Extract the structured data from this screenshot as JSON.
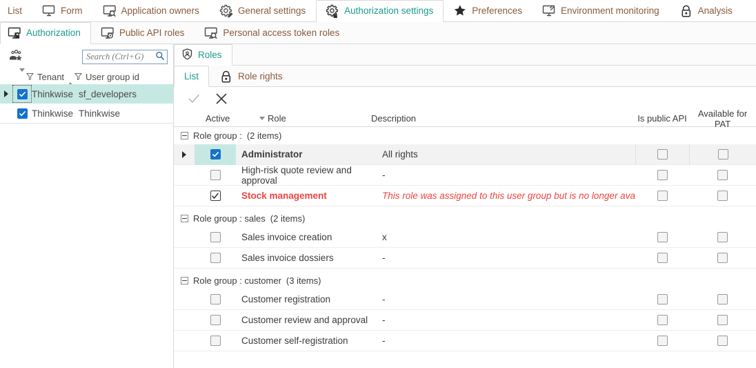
{
  "top_tabs": [
    {
      "label": "List",
      "icon": "list-icon",
      "active": false,
      "has_icon": false
    },
    {
      "label": "Form",
      "icon": "monitor-icon",
      "active": false,
      "has_icon": true
    },
    {
      "label": "Application owners",
      "icon": "monitor-search-icon",
      "active": false,
      "has_icon": true
    },
    {
      "label": "General settings",
      "icon": "gear-pencil-icon",
      "active": false,
      "has_icon": true
    },
    {
      "label": "Authorization settings",
      "icon": "gear-lock-icon",
      "active": true,
      "has_icon": true
    },
    {
      "label": "Preferences",
      "icon": "star-icon",
      "active": false,
      "has_icon": true
    },
    {
      "label": "Environment monitoring",
      "icon": "monitor-activity-icon",
      "active": false,
      "has_icon": true
    },
    {
      "label": "Analysis",
      "icon": "lock-icon",
      "active": false,
      "has_icon": true
    }
  ],
  "sub_tabs": [
    {
      "label": "Authorization",
      "icon": "monitor-lock-icon",
      "active": true
    },
    {
      "label": "Public API roles",
      "icon": "monitor-eye-icon",
      "active": false
    },
    {
      "label": "Personal access token roles",
      "icon": "monitor-search-icon",
      "active": false
    }
  ],
  "left_panel": {
    "header_icon": "user-group-star-icon",
    "search": {
      "placeholder": "Search (Ctrl+G)",
      "value": "",
      "icon": "search-icon"
    },
    "columns": [
      {
        "label": "Tenant",
        "sort": "desc",
        "filter": true
      },
      {
        "label": "User group id",
        "sort": "asc",
        "filter": true
      }
    ],
    "rows": [
      {
        "expandable": true,
        "checked": true,
        "tenant": "Thinkwise",
        "user_group_id": "sf_developers",
        "selected": true
      },
      {
        "expandable": false,
        "checked": true,
        "tenant": "Thinkwise",
        "user_group_id": "Thinkwise",
        "selected": false
      }
    ]
  },
  "right_panel": {
    "entity_tab": {
      "label": "Roles",
      "icon": "shield-user-icon",
      "active": true
    },
    "view_tabs": [
      {
        "label": "List",
        "icon": null,
        "active": true
      },
      {
        "label": "Role rights",
        "icon": "lock-icon",
        "active": false
      }
    ],
    "toolbar": [
      {
        "name": "confirm-button",
        "icon": "check-icon",
        "enabled": false
      },
      {
        "name": "cancel-button",
        "icon": "close-icon",
        "enabled": true
      }
    ],
    "grid": {
      "columns": {
        "active": "Active",
        "active_sort": "desc",
        "role": "Role",
        "description": "Description",
        "is_public_api": "Is public API",
        "available_for_pat": "Available for PAT"
      },
      "groups": [
        {
          "label": "Role group :",
          "count_label": "(2 items)",
          "collapsed": false,
          "rows": [
            {
              "expandable": true,
              "checked": true,
              "checkbox_style": "blue",
              "role": "Administrator",
              "description": "All rights",
              "is_public_api": false,
              "available_for_pat": false,
              "highlighted": true,
              "warning": false
            },
            {
              "expandable": false,
              "checked": false,
              "checkbox_style": "empty",
              "role": "High-risk quote review and approval",
              "description": "-",
              "is_public_api": false,
              "available_for_pat": false,
              "highlighted": false,
              "warning": false
            },
            {
              "expandable": false,
              "checked": true,
              "checkbox_style": "dark",
              "role": "Stock management",
              "description": "This role was assigned to this user group but is no longer availa",
              "is_public_api": false,
              "available_for_pat": false,
              "highlighted": false,
              "warning": true
            }
          ]
        },
        {
          "label": "Role group : sales",
          "count_label": "(2 items)",
          "collapsed": false,
          "rows": [
            {
              "expandable": false,
              "checked": false,
              "checkbox_style": "empty",
              "role": "Sales invoice creation",
              "description": "x",
              "is_public_api": false,
              "available_for_pat": false,
              "highlighted": false,
              "warning": false
            },
            {
              "expandable": false,
              "checked": false,
              "checkbox_style": "empty",
              "role": "Sales invoice dossiers",
              "description": "-",
              "is_public_api": false,
              "available_for_pat": false,
              "highlighted": false,
              "warning": false
            }
          ]
        },
        {
          "label": "Role group : customer",
          "count_label": "(3 items)",
          "collapsed": false,
          "rows": [
            {
              "expandable": false,
              "checked": false,
              "checkbox_style": "empty",
              "role": "Customer registration",
              "description": "-",
              "is_public_api": false,
              "available_for_pat": false,
              "highlighted": false,
              "warning": false
            },
            {
              "expandable": false,
              "checked": false,
              "checkbox_style": "empty",
              "role": "Customer review and approval",
              "description": "-",
              "is_public_api": false,
              "available_for_pat": false,
              "highlighted": false,
              "warning": false
            },
            {
              "expandable": false,
              "checked": false,
              "checkbox_style": "empty",
              "role": "Customer self-registration",
              "description": "-",
              "is_public_api": false,
              "available_for_pat": false,
              "highlighted": false,
              "warning": false
            }
          ]
        }
      ]
    }
  },
  "colors": {
    "accent": "#1a9c8c",
    "tab_text": "#8a5a3b",
    "selection": "#c6e8e3",
    "warning": "#f0433f",
    "checkbox_blue": "#1572cc"
  }
}
